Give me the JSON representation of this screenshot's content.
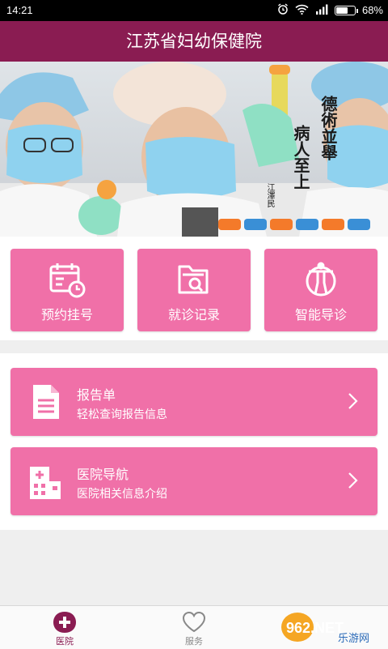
{
  "status_bar": {
    "time": "14:21",
    "battery": "68%",
    "battery_level": 0.68,
    "signal_text": "4G"
  },
  "app": {
    "title": "江苏省妇幼保健院"
  },
  "banner": {
    "calligraphy": [
      "德術並舉",
      "病人至上"
    ],
    "signature": "江澤民"
  },
  "quick_actions": [
    {
      "label": "预约挂号",
      "icon": "calendar-clock-icon"
    },
    {
      "label": "就诊记录",
      "icon": "folder-search-icon"
    },
    {
      "label": "智能导诊",
      "icon": "body-guide-icon"
    }
  ],
  "cards": [
    {
      "title": "报告单",
      "subtitle": "轻松查询报告信息",
      "icon": "document-icon"
    },
    {
      "title": "医院导航",
      "subtitle": "医院相关信息介绍",
      "icon": "hospital-building-icon"
    }
  ],
  "tabs": [
    {
      "label": "医院",
      "icon": "hospital-cross-icon",
      "active": true
    },
    {
      "label": "服务",
      "icon": "heart-icon",
      "active": false
    }
  ],
  "watermark": {
    "brand": "962.NET",
    "sub": "乐游网"
  },
  "colors": {
    "primary": "#8a1c52",
    "accent": "#f070a8",
    "background": "#efefef"
  }
}
